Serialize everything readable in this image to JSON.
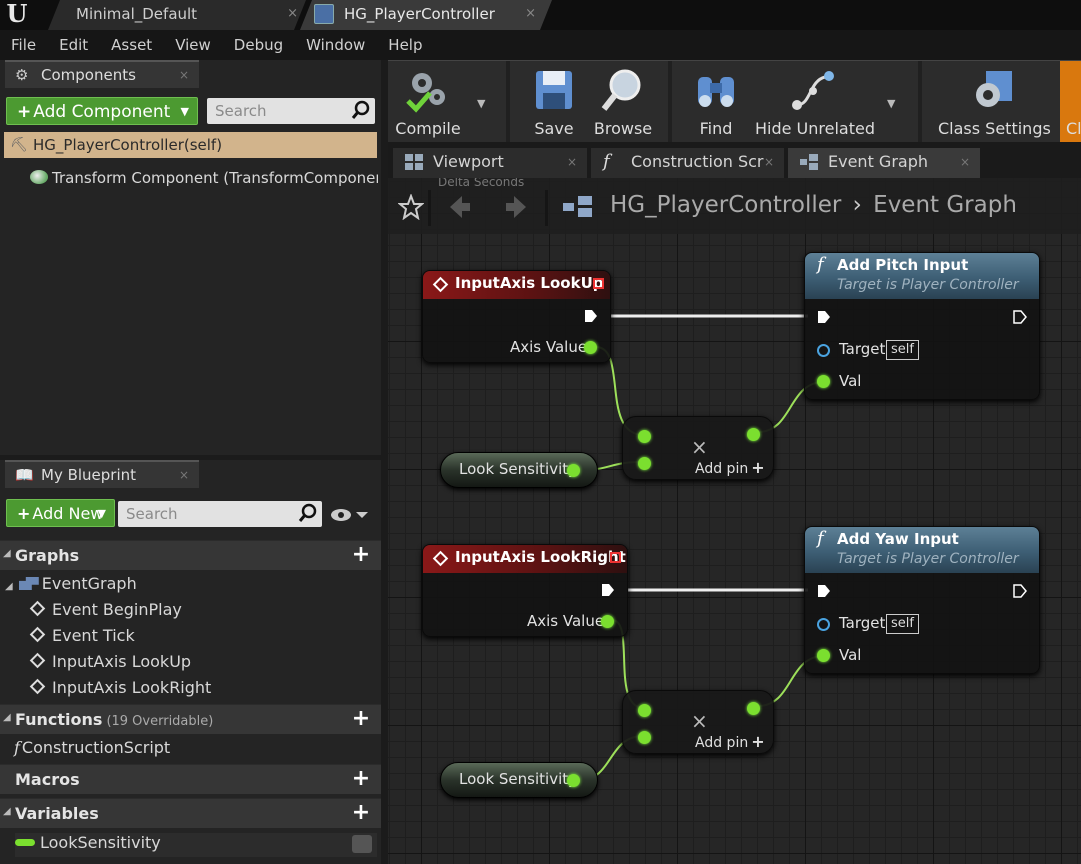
{
  "tabs": {
    "tab1": "Minimal_Default",
    "tab2": "HG_PlayerController",
    "close": "×"
  },
  "menu": [
    "File",
    "Edit",
    "Asset",
    "View",
    "Debug",
    "Window",
    "Help"
  ],
  "components": {
    "tab_label": "Components",
    "add_label": "Add Component",
    "search_placeholder": "Search",
    "self_item": "HG_PlayerController(self)",
    "transform_item": "Transform Component (TransformComponent)"
  },
  "my_blueprint": {
    "tab_label": "My Blueprint",
    "add_new_label": "Add New",
    "search_placeholder": "Search",
    "graphs_label": "Graphs",
    "event_graph": "EventGraph",
    "events": [
      "Event BeginPlay",
      "Event Tick",
      "InputAxis LookUp",
      "InputAxis LookRight"
    ],
    "functions_label": "Functions",
    "functions_sub": "(19 Overridable)",
    "construction_script": "ConstructionScript",
    "macros_label": "Macros",
    "variables_label": "Variables",
    "variable_item": "LookSensitivity"
  },
  "toolbar": {
    "compile": "Compile",
    "save": "Save",
    "browse": "Browse",
    "find": "Find",
    "hide_unrelated": "Hide Unrelated",
    "class_settings": "Class Settings",
    "partial": "Cl"
  },
  "graph_tabs": {
    "viewport": "Viewport",
    "construction": "Construction Script",
    "event_graph": "Event Graph"
  },
  "breadcrumb": {
    "blueprint": "HG_PlayerController",
    "separator": "›",
    "graph": "Event Graph",
    "ghost": "Delta Seconds"
  },
  "nodes": {
    "lookup_title": "InputAxis LookUp",
    "lookright_title": "InputAxis LookRight",
    "axis_value": "Axis Value",
    "pitch_title": "Add Pitch Input",
    "yaw_title": "Add Yaw Input",
    "target_is": "Target is Player Controller",
    "target": "Target",
    "self": "self",
    "val": "Val",
    "look_sensitivity": "Look Sensitivity",
    "add_pin": "Add pin",
    "mul_symbol": "×",
    "func_symbol": "f"
  },
  "colors": {
    "accent_green": "#4c9a31",
    "selection": "#d2b48c",
    "float_pin": "#7bdf2f",
    "event_header": "#8a1818",
    "function_header": "#5d8096"
  }
}
